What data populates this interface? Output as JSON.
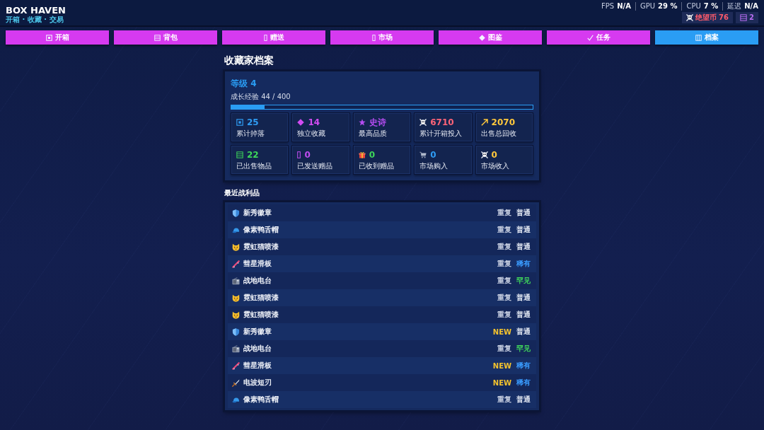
{
  "app": {
    "title": "BOX HAVEN",
    "subtitle": "开箱 · 收藏 · 交易"
  },
  "perf_overlay": [
    {
      "label": "FPS",
      "value": "N/A"
    },
    {
      "label": "GPU",
      "value": "29 %"
    },
    {
      "label": "CPU",
      "value": "7 %"
    },
    {
      "label": "延迟",
      "value": "N/A"
    }
  ],
  "currencies": [
    {
      "kind": "coin",
      "label": "绝望币",
      "value": "76",
      "color": "#ff5a6a"
    },
    {
      "kind": "ticket",
      "value": "2",
      "color": "#b86cf2"
    }
  ],
  "tabs": [
    {
      "kind": "open",
      "label": "开箱",
      "selected": false
    },
    {
      "kind": "bag",
      "label": "背包",
      "selected": false
    },
    {
      "kind": "gift",
      "label": "赠送",
      "selected": false
    },
    {
      "kind": "market",
      "label": "市场",
      "selected": false
    },
    {
      "kind": "codex",
      "label": "图鉴",
      "selected": false
    },
    {
      "kind": "quests",
      "label": "任务",
      "selected": false
    },
    {
      "kind": "profile",
      "label": "档案",
      "selected": true
    }
  ],
  "profile": {
    "title": "收藏家档案",
    "level": "等级 4",
    "xp_text": "成长经验 44 / 400",
    "xp_bar": {
      "level": 0.11
    },
    "stats": [
      {
        "kind": "drops",
        "value": "25",
        "label": "累计掉落",
        "color": "#2f9cf4"
      },
      {
        "kind": "unique",
        "value": "14",
        "label": "独立收藏",
        "color": "#d24cf2"
      },
      {
        "kind": "quality",
        "value": "史诗",
        "label": "最高品质",
        "color": "#b44cf0"
      },
      {
        "kind": "spent",
        "value": "6710",
        "label": "累计开箱投入",
        "color": "#ff6478"
      },
      {
        "kind": "returns",
        "value": "2070",
        "label": "出售总回收",
        "color": "#ffc83c"
      },
      {
        "kind": "sold",
        "value": "22",
        "label": "已出售物品",
        "color": "#3ed65a"
      },
      {
        "kind": "sent",
        "value": "0",
        "label": "已发送赠品",
        "color": "#c04cf0"
      },
      {
        "kind": "received",
        "value": "0",
        "label": "已收到赠品",
        "color": "#3ed65a"
      },
      {
        "kind": "bought",
        "value": "0",
        "label": "市场购入",
        "color": "#2f9cf4"
      },
      {
        "kind": "income",
        "value": "0",
        "label": "市场收入",
        "color": "#ffc83c"
      }
    ]
  },
  "recent_loot": {
    "title": "最近战利品",
    "items": [
      {
        "kind": "badge",
        "name": "新秀徽章",
        "tag": "重复",
        "new": false,
        "rarity": "普通",
        "color": "#dfe5f0"
      },
      {
        "kind": "cap",
        "name": "像素鸭舌帽",
        "tag": "重复",
        "new": false,
        "rarity": "普通",
        "color": "#dfe5f0"
      },
      {
        "kind": "spray",
        "name": "霓虹猫喷漆",
        "tag": "重复",
        "new": false,
        "rarity": "普通",
        "color": "#dfe5f0"
      },
      {
        "kind": "skateboard",
        "name": "彗星滑板",
        "tag": "重复",
        "new": false,
        "rarity": "稀有",
        "color": "#3a9cff"
      },
      {
        "kind": "radio",
        "name": "战地电台",
        "tag": "重复",
        "new": false,
        "rarity": "罕见",
        "color": "#3fd35b"
      },
      {
        "kind": "spray",
        "name": "霓虹猫喷漆",
        "tag": "重复",
        "new": false,
        "rarity": "普通",
        "color": "#dfe5f0"
      },
      {
        "kind": "spray",
        "name": "霓虹猫喷漆",
        "tag": "重复",
        "new": false,
        "rarity": "普通",
        "color": "#dfe5f0"
      },
      {
        "kind": "badge",
        "name": "新秀徽章",
        "tag": "NEW",
        "new": true,
        "rarity": "普通",
        "color": "#dfe5f0"
      },
      {
        "kind": "radio",
        "name": "战地电台",
        "tag": "重复",
        "new": false,
        "rarity": "罕见",
        "color": "#3fd35b"
      },
      {
        "kind": "skateboard",
        "name": "彗星滑板",
        "tag": "NEW",
        "new": true,
        "rarity": "稀有",
        "color": "#3a9cff"
      },
      {
        "kind": "blade",
        "name": "电波短刃",
        "tag": "NEW",
        "new": true,
        "rarity": "稀有",
        "color": "#3a9cff"
      },
      {
        "kind": "cap",
        "name": "像素鸭舌帽",
        "tag": "重复",
        "new": false,
        "rarity": "普通",
        "color": "#dfe5f0"
      }
    ]
  }
}
